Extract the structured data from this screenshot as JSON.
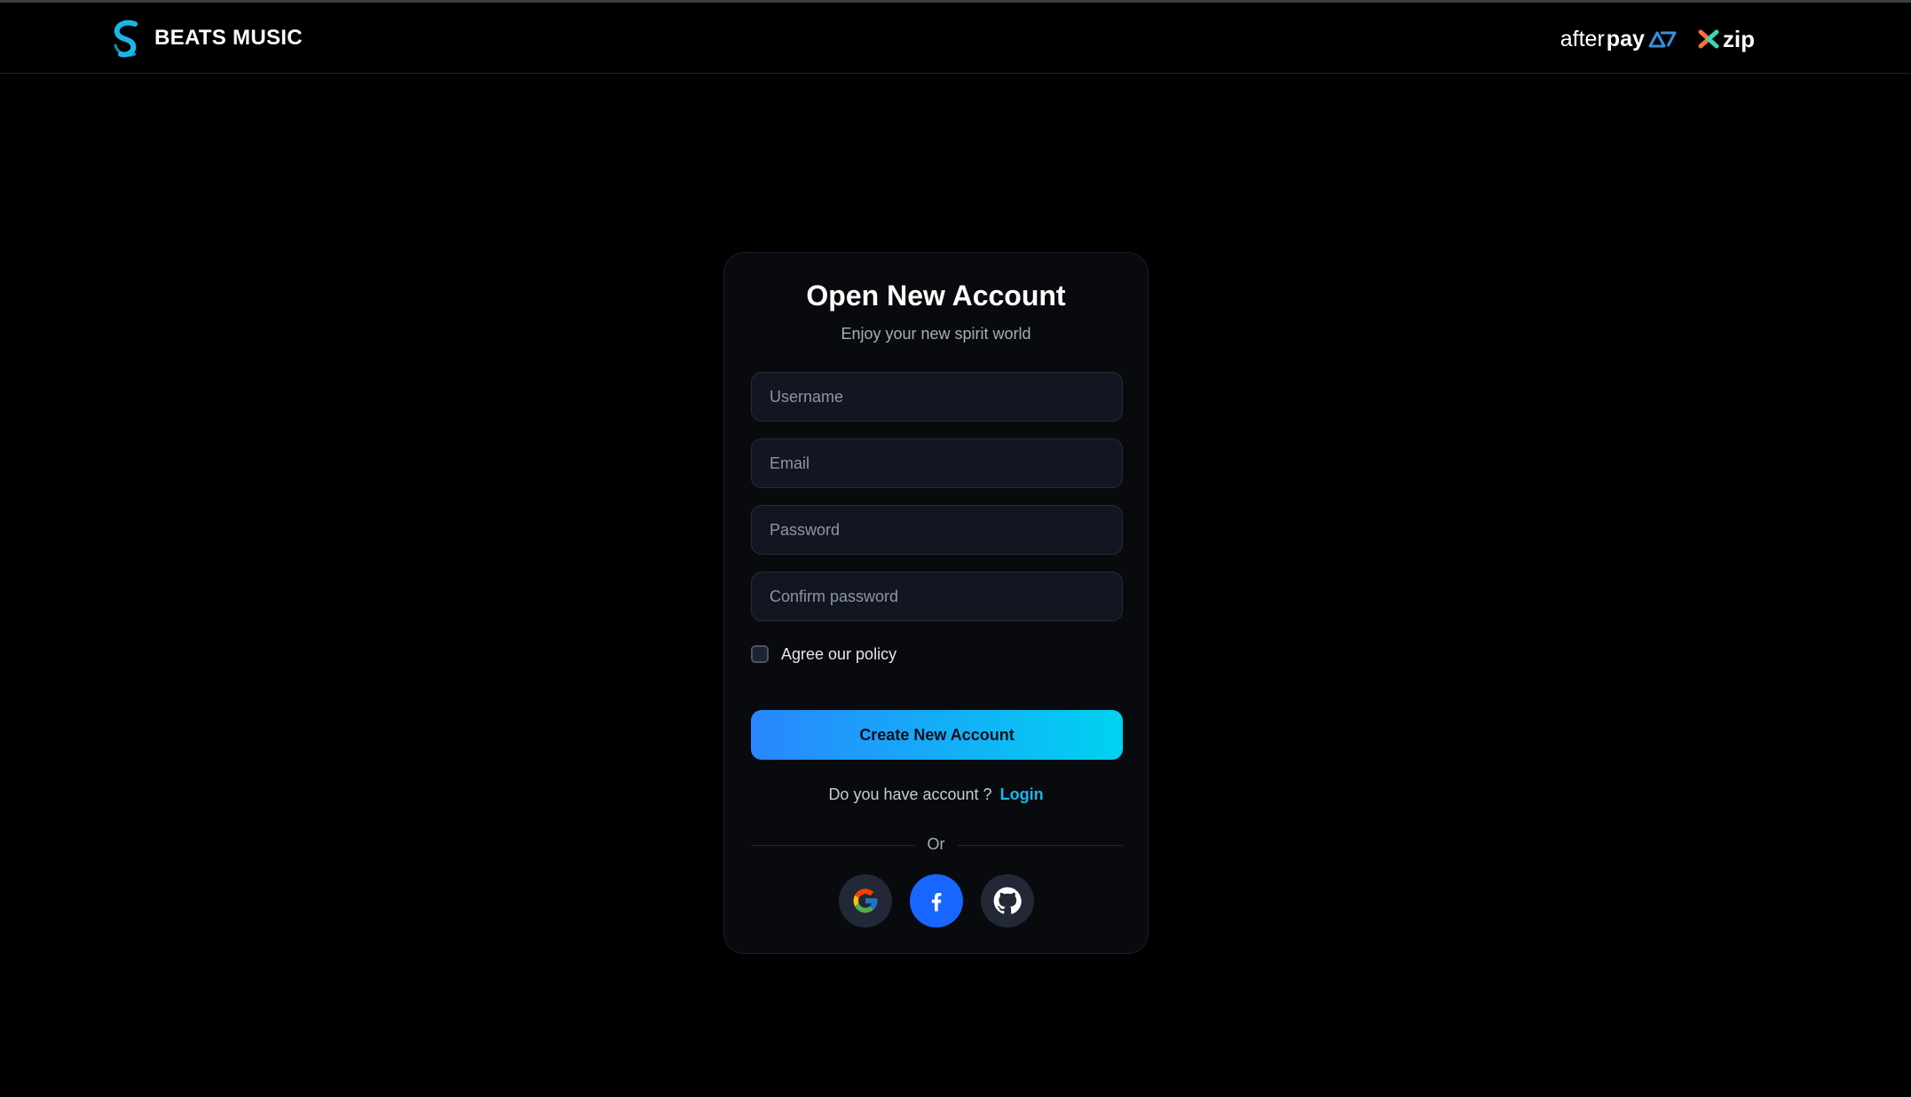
{
  "header": {
    "brand_name": "BEATS MUSIC",
    "partners": {
      "afterpay_prefix": "after",
      "afterpay_suffix": "pay",
      "zip_label": "zip"
    }
  },
  "card": {
    "title": "Open New Account",
    "subtitle": "Enjoy your new spirit world",
    "fields": {
      "username_placeholder": "Username",
      "email_placeholder": "Email",
      "password_placeholder": "Password",
      "confirm_placeholder": "Confirm password"
    },
    "policy_label": "Agree our policy",
    "policy_checked": false,
    "create_button_label": "Create New Account",
    "login_prompt": "Do you have account ?",
    "login_link": "Login",
    "divider_text": "Or",
    "social": {
      "google_icon": "google-icon",
      "facebook_icon": "facebook-icon",
      "github_icon": "github-icon"
    }
  },
  "colors": {
    "background": "#000000",
    "card_background": "#080a0e",
    "accent_gradient_start": "#2a86ff",
    "accent_gradient_end": "#00d2f0",
    "link": "#1bb6e8",
    "facebook": "#1766ff"
  }
}
